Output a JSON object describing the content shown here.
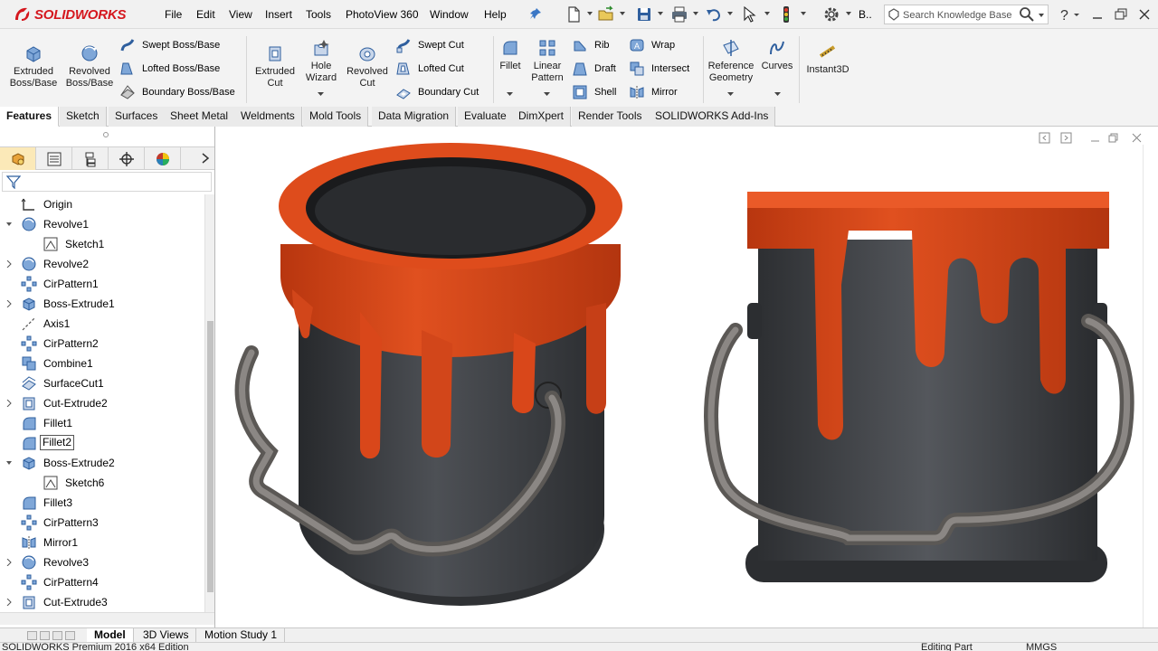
{
  "app": {
    "logo_text": "SOLIDWORKS",
    "brand_color": "#d5171e",
    "menu": [
      "File",
      "Edit",
      "View",
      "Insert",
      "Tools",
      "PhotoView 360",
      "Window",
      "Help"
    ],
    "quick_access_overflow": "B..",
    "search": {
      "placeholder": "Search Knowledge Base"
    }
  },
  "ribbon": {
    "extruded_boss": [
      "Extruded",
      "Boss/Base"
    ],
    "revolved_boss": [
      "Revolved",
      "Boss/Base"
    ],
    "swept_boss": "Swept Boss/Base",
    "lofted_boss": "Lofted Boss/Base",
    "boundary_boss": "Boundary Boss/Base",
    "extruded_cut": [
      "Extruded",
      "Cut"
    ],
    "hole_wizard": [
      "Hole",
      "Wizard"
    ],
    "revolved_cut": [
      "Revolved",
      "Cut"
    ],
    "swept_cut": "Swept Cut",
    "lofted_cut": "Lofted Cut",
    "boundary_cut": "Boundary Cut",
    "fillet": "Fillet",
    "linear_pattern": [
      "Linear",
      "Pattern"
    ],
    "rib": "Rib",
    "draft": "Draft",
    "shell": "Shell",
    "wrap": "Wrap",
    "intersect": "Intersect",
    "mirror": "Mirror",
    "reference_geometry": [
      "Reference",
      "Geometry"
    ],
    "curves": "Curves",
    "instant3d": "Instant3D"
  },
  "tabs": [
    "Features",
    "Sketch",
    "Surfaces",
    "Sheet Metal",
    "Weldments",
    "Mold Tools",
    "Data Migration",
    "Evaluate",
    "DimXpert",
    "Render Tools",
    "SOLIDWORKS Add-Ins"
  ],
  "active_tab": "Features",
  "tree": [
    {
      "label": "Origin",
      "icon": "origin-icon",
      "expander": false
    },
    {
      "label": "Revolve1",
      "icon": "revolve-icon",
      "expander": true,
      "expanded": true
    },
    {
      "label": "Sketch1",
      "icon": "sketch-icon",
      "expander": false,
      "child": true
    },
    {
      "label": "Revolve2",
      "icon": "revolve-icon",
      "expander": true
    },
    {
      "label": "CirPattern1",
      "icon": "circular-pattern-icon",
      "expander": false
    },
    {
      "label": "Boss-Extrude1",
      "icon": "extrude-icon",
      "expander": true
    },
    {
      "label": "Axis1",
      "icon": "axis-icon",
      "expander": false
    },
    {
      "label": "CirPattern2",
      "icon": "circular-pattern-icon",
      "expander": false
    },
    {
      "label": "Combine1",
      "icon": "combine-icon",
      "expander": false
    },
    {
      "label": "SurfaceCut1",
      "icon": "surface-cut-icon",
      "expander": false
    },
    {
      "label": "Cut-Extrude2",
      "icon": "cut-extrude-icon",
      "expander": true
    },
    {
      "label": "Fillet1",
      "icon": "fillet-icon",
      "expander": false
    },
    {
      "label": "Fillet2",
      "icon": "fillet-icon",
      "expander": false,
      "selected": true
    },
    {
      "label": "Boss-Extrude2",
      "icon": "extrude-icon",
      "expander": true,
      "expanded": true
    },
    {
      "label": "Sketch6",
      "icon": "sketch-icon",
      "expander": false,
      "child": true
    },
    {
      "label": "Fillet3",
      "icon": "fillet-icon",
      "expander": false
    },
    {
      "label": "CirPattern3",
      "icon": "circular-pattern-icon",
      "expander": false
    },
    {
      "label": "Mirror1",
      "icon": "mirror-icon",
      "expander": false
    },
    {
      "label": "Revolve3",
      "icon": "revolve-icon",
      "expander": true
    },
    {
      "label": "CirPattern4",
      "icon": "circular-pattern-icon",
      "expander": false
    },
    {
      "label": "Cut-Extrude3",
      "icon": "cut-extrude-icon",
      "expander": true
    }
  ],
  "bottom_tabs": [
    "Model",
    "3D Views",
    "Motion Study 1"
  ],
  "active_bottom_tab": "Model",
  "status": {
    "left": "SOLIDWORKS Premium 2016 x64 Edition",
    "mode": "Editing Part",
    "units": "MMGS"
  },
  "colors": {
    "paint_orange": "#d9471a",
    "can_body": "#3b3d40",
    "handle": "#77736f",
    "tree_selected_tab": "#fbe9b8"
  }
}
